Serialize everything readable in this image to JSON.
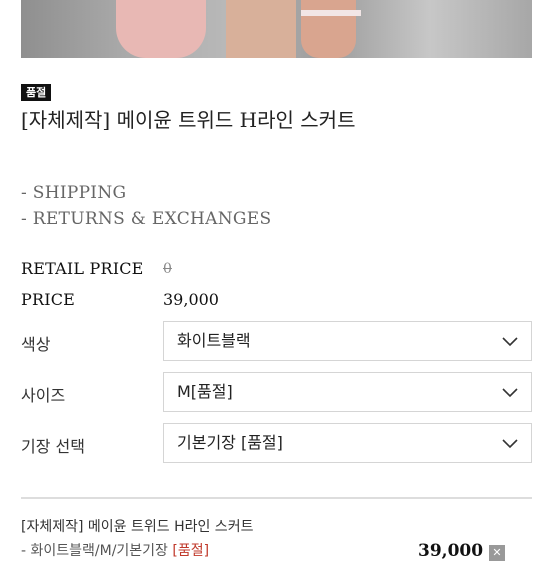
{
  "product": {
    "badge": "품절",
    "title": "[자체제작] 메이윤 트위드 H라인 스커트"
  },
  "links": {
    "shipping": "- SHIPPING",
    "returns": "- RETURNS & EXCHANGES"
  },
  "pricing": {
    "retail_label": "RETAIL PRICE",
    "retail_value": "0",
    "price_label": "PRICE",
    "price_value": "39,000"
  },
  "options": [
    {
      "label": "색상",
      "selected": "화이트블랙"
    },
    {
      "label": "사이즈",
      "selected": "M[품절]"
    },
    {
      "label": "기장 선택",
      "selected": "기본기장 [품절]"
    }
  ],
  "summary": {
    "name": "[자체제작] 메이윤 트위드 H라인 스커트",
    "option_text": "- 화이트블랙/M/기본기장",
    "option_soldout": "[품절]",
    "price": "39,000",
    "remove_icon": "close-icon"
  },
  "colors": {
    "badge_bg": "#111111",
    "soldout_text": "#c0392b",
    "border": "#d5d5d5"
  }
}
